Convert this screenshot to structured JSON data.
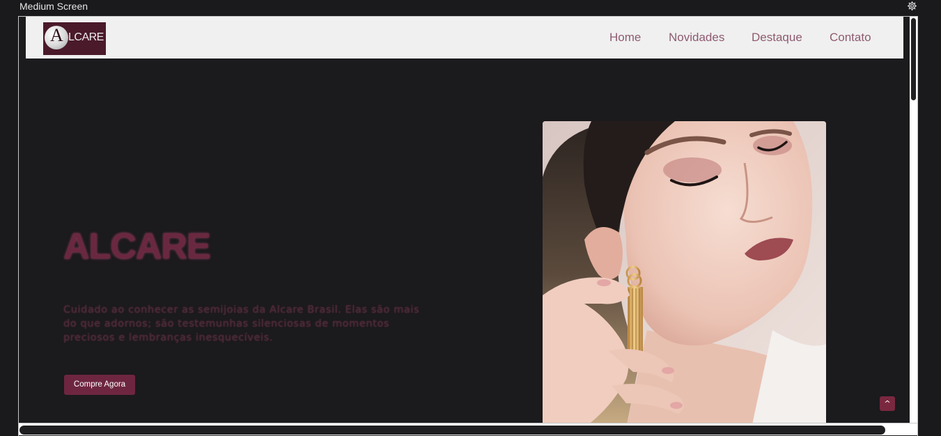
{
  "window": {
    "title": "Medium Screen",
    "settings_icon": "gear-icon"
  },
  "header": {
    "logo_letter": "A",
    "logo_text": "LCARE",
    "nav": [
      {
        "label": "Home"
      },
      {
        "label": "Novidades"
      },
      {
        "label": "Destaque"
      },
      {
        "label": "Contato"
      }
    ]
  },
  "hero": {
    "title": "ALCARE",
    "description": "Cuidado ao conhecer as semijoias da Alcare Brasil. Elas são mais do que adornos; são testemunhas silenciosas de momentos preciosos e lembranças inesquecíveis.",
    "cta_label": "Compre Agora",
    "image_icon": "model-wearing-earring-photo"
  },
  "back_to_top": {
    "label": "^"
  },
  "colors": {
    "page_background": "#1b1a1d",
    "navbar_background": "#f0f0f0",
    "accent": "#6e2640",
    "nav_link": "#8e5a70"
  }
}
